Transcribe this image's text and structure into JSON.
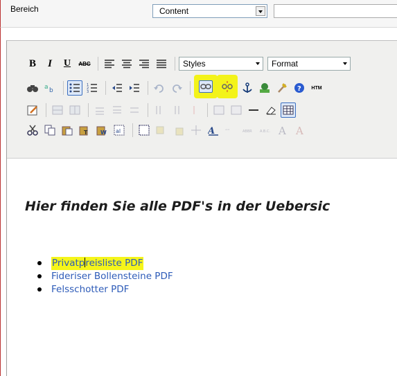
{
  "form": {
    "bereich_label": "Bereich",
    "content_value": "Content"
  },
  "toolbar": {
    "row1": {
      "bold": "B",
      "italic": "I",
      "underline": "U",
      "strike": "ABC",
      "styles_label": "Styles",
      "format_label": "Format"
    },
    "row2": {
      "html_label": "HTM"
    }
  },
  "content": {
    "heading": "Hier finden Sie alle PDF's in der Uebersic",
    "items": [
      {
        "before_caret": "Privatp",
        "after_caret": "reisliste PDF"
      },
      {
        "label": "Fideriser Bollensteine PDF"
      },
      {
        "label": "Felsschotter PDF"
      }
    ]
  },
  "highlight": {
    "yellow": "#f3f31a",
    "link_blue": "#2d5bb8"
  }
}
